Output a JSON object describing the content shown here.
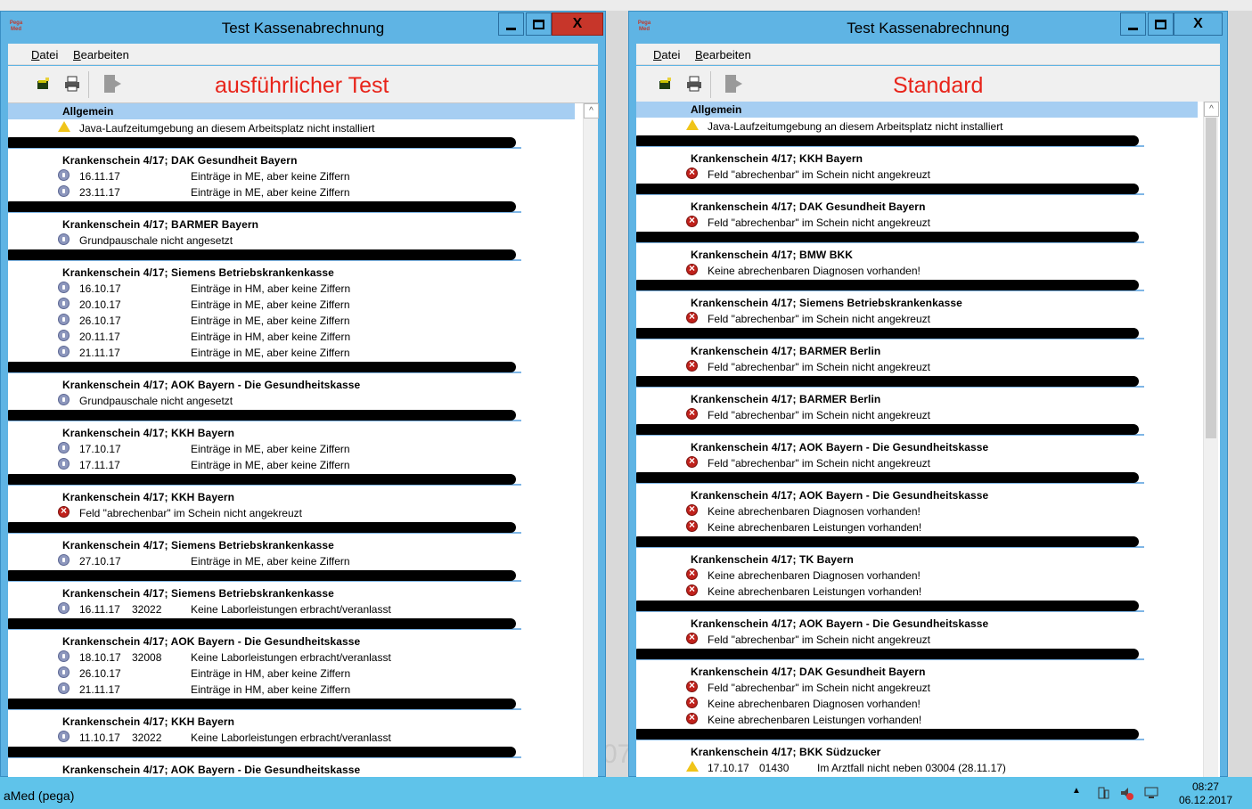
{
  "windows": [
    {
      "title": "Test Kassenabrechnung",
      "menu": [
        "Datei",
        "Bearbeiten"
      ],
      "label": "ausführlicher Test",
      "rows": [
        {
          "kind": "header",
          "text": "Allgemein"
        },
        {
          "kind": "item",
          "icon": "warning-icon",
          "c1": "Java-Laufzeitumgebung an diesem Arbeitsplatz nicht installiert"
        },
        {
          "kind": "redact"
        },
        {
          "kind": "kasse",
          "text": "Krankenschein 4/17; DAK Gesundheit Bayern"
        },
        {
          "kind": "item",
          "icon": "info-icon",
          "c1": "16.11.17",
          "c3": "Einträge in ME, aber keine Ziffern"
        },
        {
          "kind": "item",
          "icon": "info-icon",
          "c1": "23.11.17",
          "c3": "Einträge in ME, aber keine Ziffern"
        },
        {
          "kind": "redact"
        },
        {
          "kind": "kasse",
          "text": "Krankenschein 4/17; BARMER Bayern"
        },
        {
          "kind": "item",
          "icon": "info-icon",
          "c1": "Grundpauschale nicht angesetzt"
        },
        {
          "kind": "redact"
        },
        {
          "kind": "kasse",
          "text": "Krankenschein 4/17; Siemens Betriebskrankenkasse"
        },
        {
          "kind": "item",
          "icon": "info-icon",
          "c1": "16.10.17",
          "c3": "Einträge in HM, aber keine Ziffern"
        },
        {
          "kind": "item",
          "icon": "info-icon",
          "c1": "20.10.17",
          "c3": "Einträge in ME, aber keine Ziffern"
        },
        {
          "kind": "item",
          "icon": "info-icon",
          "c1": "26.10.17",
          "c3": "Einträge in ME, aber keine Ziffern"
        },
        {
          "kind": "item",
          "icon": "info-icon",
          "c1": "20.11.17",
          "c3": "Einträge in HM, aber keine Ziffern"
        },
        {
          "kind": "item",
          "icon": "info-icon",
          "c1": "21.11.17",
          "c3": "Einträge in ME, aber keine Ziffern"
        },
        {
          "kind": "redact"
        },
        {
          "kind": "kasse",
          "text": "Krankenschein 4/17; AOK Bayern - Die Gesundheitskasse"
        },
        {
          "kind": "item",
          "icon": "info-icon",
          "c1": "Grundpauschale nicht angesetzt"
        },
        {
          "kind": "redact"
        },
        {
          "kind": "kasse",
          "text": "Krankenschein 4/17; KKH Bayern"
        },
        {
          "kind": "item",
          "icon": "info-icon",
          "c1": "17.10.17",
          "c3": "Einträge in ME, aber keine Ziffern"
        },
        {
          "kind": "item",
          "icon": "info-icon",
          "c1": "17.11.17",
          "c3": "Einträge in ME, aber keine Ziffern"
        },
        {
          "kind": "redact"
        },
        {
          "kind": "kasse",
          "text": "Krankenschein 4/17; KKH Bayern"
        },
        {
          "kind": "item",
          "icon": "error-icon",
          "c1": "Feld \"abrechenbar\" im Schein nicht angekreuzt"
        },
        {
          "kind": "redact"
        },
        {
          "kind": "kasse",
          "text": "Krankenschein 4/17; Siemens Betriebskrankenkasse"
        },
        {
          "kind": "item",
          "icon": "info-icon",
          "c1": "27.10.17",
          "c3": "Einträge in ME, aber keine Ziffern"
        },
        {
          "kind": "redact"
        },
        {
          "kind": "kasse",
          "text": "Krankenschein 4/17; Siemens Betriebskrankenkasse"
        },
        {
          "kind": "item",
          "icon": "info-icon",
          "c1": "16.11.17",
          "c2": "32022",
          "c3": "Keine Laborleistungen erbracht/veranlasst"
        },
        {
          "kind": "redact"
        },
        {
          "kind": "kasse",
          "text": "Krankenschein 4/17; AOK Bayern - Die Gesundheitskasse"
        },
        {
          "kind": "item",
          "icon": "info-icon",
          "c1": "18.10.17",
          "c2": "32008",
          "c3": "Keine Laborleistungen erbracht/veranlasst"
        },
        {
          "kind": "item",
          "icon": "info-icon",
          "c1": "26.10.17",
          "c3": "Einträge in HM, aber keine Ziffern"
        },
        {
          "kind": "item",
          "icon": "info-icon",
          "c1": "21.11.17",
          "c3": "Einträge in HM, aber keine Ziffern"
        },
        {
          "kind": "redact"
        },
        {
          "kind": "kasse",
          "text": "Krankenschein 4/17; KKH Bayern"
        },
        {
          "kind": "item",
          "icon": "info-icon",
          "c1": "11.10.17",
          "c2": "32022",
          "c3": "Keine Laborleistungen erbracht/veranlasst"
        },
        {
          "kind": "redact"
        },
        {
          "kind": "kasse",
          "text": "Krankenschein 4/17; AOK Bayern - Die Gesundheitskasse"
        }
      ]
    },
    {
      "title": "Test Kassenabrechnung",
      "menu": [
        "Datei",
        "Bearbeiten"
      ],
      "label": "Standard",
      "rows": [
        {
          "kind": "header",
          "text": "Allgemein"
        },
        {
          "kind": "item",
          "icon": "warning-icon",
          "c1": "Java-Laufzeitumgebung an diesem Arbeitsplatz nicht installiert"
        },
        {
          "kind": "redact"
        },
        {
          "kind": "kasse",
          "text": "Krankenschein 4/17; KKH Bayern"
        },
        {
          "kind": "item",
          "icon": "error-icon",
          "c1": "Feld \"abrechenbar\" im Schein nicht angekreuzt"
        },
        {
          "kind": "redact"
        },
        {
          "kind": "kasse",
          "text": "Krankenschein 4/17; DAK Gesundheit Bayern"
        },
        {
          "kind": "item",
          "icon": "error-icon",
          "c1": "Feld \"abrechenbar\" im Schein nicht angekreuzt"
        },
        {
          "kind": "redact"
        },
        {
          "kind": "kasse",
          "text": "Krankenschein 4/17; BMW BKK"
        },
        {
          "kind": "item",
          "icon": "error-icon",
          "c1": "Keine abrechenbaren Diagnosen vorhanden!"
        },
        {
          "kind": "redact"
        },
        {
          "kind": "kasse",
          "text": "Krankenschein 4/17; Siemens Betriebskrankenkasse"
        },
        {
          "kind": "item",
          "icon": "error-icon",
          "c1": "Feld \"abrechenbar\" im Schein nicht angekreuzt"
        },
        {
          "kind": "redact"
        },
        {
          "kind": "kasse",
          "text": "Krankenschein 4/17; BARMER Berlin"
        },
        {
          "kind": "item",
          "icon": "error-icon",
          "c1": "Feld \"abrechenbar\" im Schein nicht angekreuzt"
        },
        {
          "kind": "redact"
        },
        {
          "kind": "kasse",
          "text": "Krankenschein 4/17; BARMER Berlin"
        },
        {
          "kind": "item",
          "icon": "error-icon",
          "c1": "Feld \"abrechenbar\" im Schein nicht angekreuzt"
        },
        {
          "kind": "redact"
        },
        {
          "kind": "kasse",
          "text": "Krankenschein 4/17; AOK Bayern - Die Gesundheitskasse"
        },
        {
          "kind": "item",
          "icon": "error-icon",
          "c1": "Feld \"abrechenbar\" im Schein nicht angekreuzt"
        },
        {
          "kind": "redact"
        },
        {
          "kind": "kasse",
          "text": "Krankenschein 4/17; AOK Bayern - Die Gesundheitskasse"
        },
        {
          "kind": "item",
          "icon": "error-icon",
          "c1": "Keine abrechenbaren Diagnosen vorhanden!"
        },
        {
          "kind": "item",
          "icon": "error-icon",
          "c1": "Keine abrechenbaren Leistungen vorhanden!"
        },
        {
          "kind": "redact"
        },
        {
          "kind": "kasse",
          "text": "Krankenschein 4/17; TK Bayern"
        },
        {
          "kind": "item",
          "icon": "error-icon",
          "c1": "Keine abrechenbaren Diagnosen vorhanden!"
        },
        {
          "kind": "item",
          "icon": "error-icon",
          "c1": "Keine abrechenbaren Leistungen vorhanden!"
        },
        {
          "kind": "redact"
        },
        {
          "kind": "kasse",
          "text": "Krankenschein 4/17; AOK Bayern - Die Gesundheitskasse"
        },
        {
          "kind": "item",
          "icon": "error-icon",
          "c1": "Feld \"abrechenbar\" im Schein nicht angekreuzt"
        },
        {
          "kind": "redact"
        },
        {
          "kind": "kasse",
          "text": "Krankenschein 4/17; DAK Gesundheit Bayern"
        },
        {
          "kind": "item",
          "icon": "error-icon",
          "c1": "Feld \"abrechenbar\" im Schein nicht angekreuzt"
        },
        {
          "kind": "item",
          "icon": "error-icon",
          "c1": "Keine abrechenbaren Diagnosen vorhanden!"
        },
        {
          "kind": "item",
          "icon": "error-icon",
          "c1": "Keine abrechenbaren Leistungen vorhanden!"
        },
        {
          "kind": "redact"
        },
        {
          "kind": "kasse",
          "text": "Krankenschein 4/17; BKK Südzucker"
        },
        {
          "kind": "item",
          "icon": "warning-icon",
          "c1": "17.10.17",
          "c2": "01430",
          "c3": "Im Arztfall nicht neben 03004 (28.11.17)"
        }
      ]
    }
  ],
  "taskbar": {
    "item": "aMed (pega)",
    "time": "08:27",
    "date": "06.12.2017",
    "tray_icons": [
      "chevron-up-icon",
      "network-icon",
      "volume-muted-icon",
      "display-icon"
    ]
  },
  "colors": {
    "titlebar": "#5fb4e4",
    "close": "#c7362a",
    "label_red": "#e8241a",
    "header_row": "#a6cef2"
  }
}
